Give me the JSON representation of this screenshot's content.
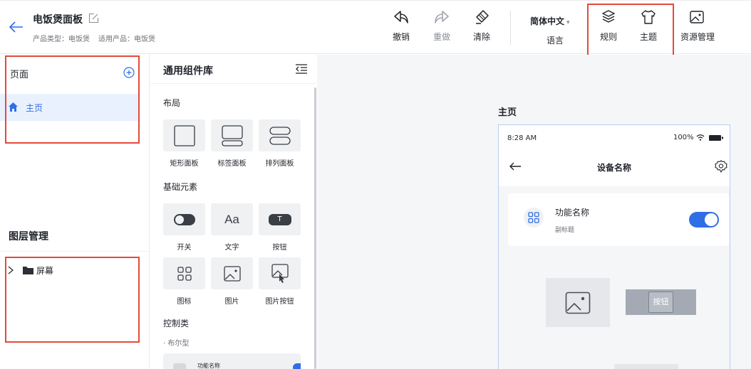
{
  "header": {
    "project_title": "电饭煲面板",
    "product_type": "产品类型：电饭煲",
    "applicable_product": "适用产品：电饭煲"
  },
  "toolbar": {
    "undo": "撤销",
    "redo": "重做",
    "clear": "清除",
    "language_value": "简体中文",
    "language_label": "语言",
    "rules": "规则",
    "theme": "主题",
    "resources": "资源管理"
  },
  "pages_panel": {
    "title": "页面",
    "items": [
      {
        "label": "主页",
        "icon": "home-icon",
        "selected": true
      }
    ]
  },
  "layers_panel": {
    "title": "图层管理",
    "tree": [
      {
        "label": "屏幕",
        "icon": "folder-icon",
        "expanded": false
      }
    ]
  },
  "library": {
    "title": "通用组件库",
    "sections": [
      {
        "title": "布局",
        "items": [
          "矩形面板",
          "标签面板",
          "排列面板"
        ]
      },
      {
        "title": "基础元素",
        "items": [
          "开关",
          "文字",
          "按钮",
          "图标",
          "图片",
          "图片按钮"
        ]
      },
      {
        "title": "控制类",
        "subtitle": "· 布尔型"
      }
    ],
    "text_icon_glyph": "Aa",
    "button_icon_glyph": "T",
    "preview_label": "功能名称"
  },
  "canvas": {
    "page_title": "主页",
    "phone": {
      "time": "8:28 AM",
      "battery": "100%",
      "nav_title": "设备名称",
      "card_title": "功能名称",
      "card_subtitle": "副标题",
      "toggle_on": true,
      "button_label": "按钮"
    }
  },
  "colors": {
    "accent": "#2f6ee5",
    "highlight_box": "#e34a3a",
    "selected_bg": "#eaf1fe"
  }
}
